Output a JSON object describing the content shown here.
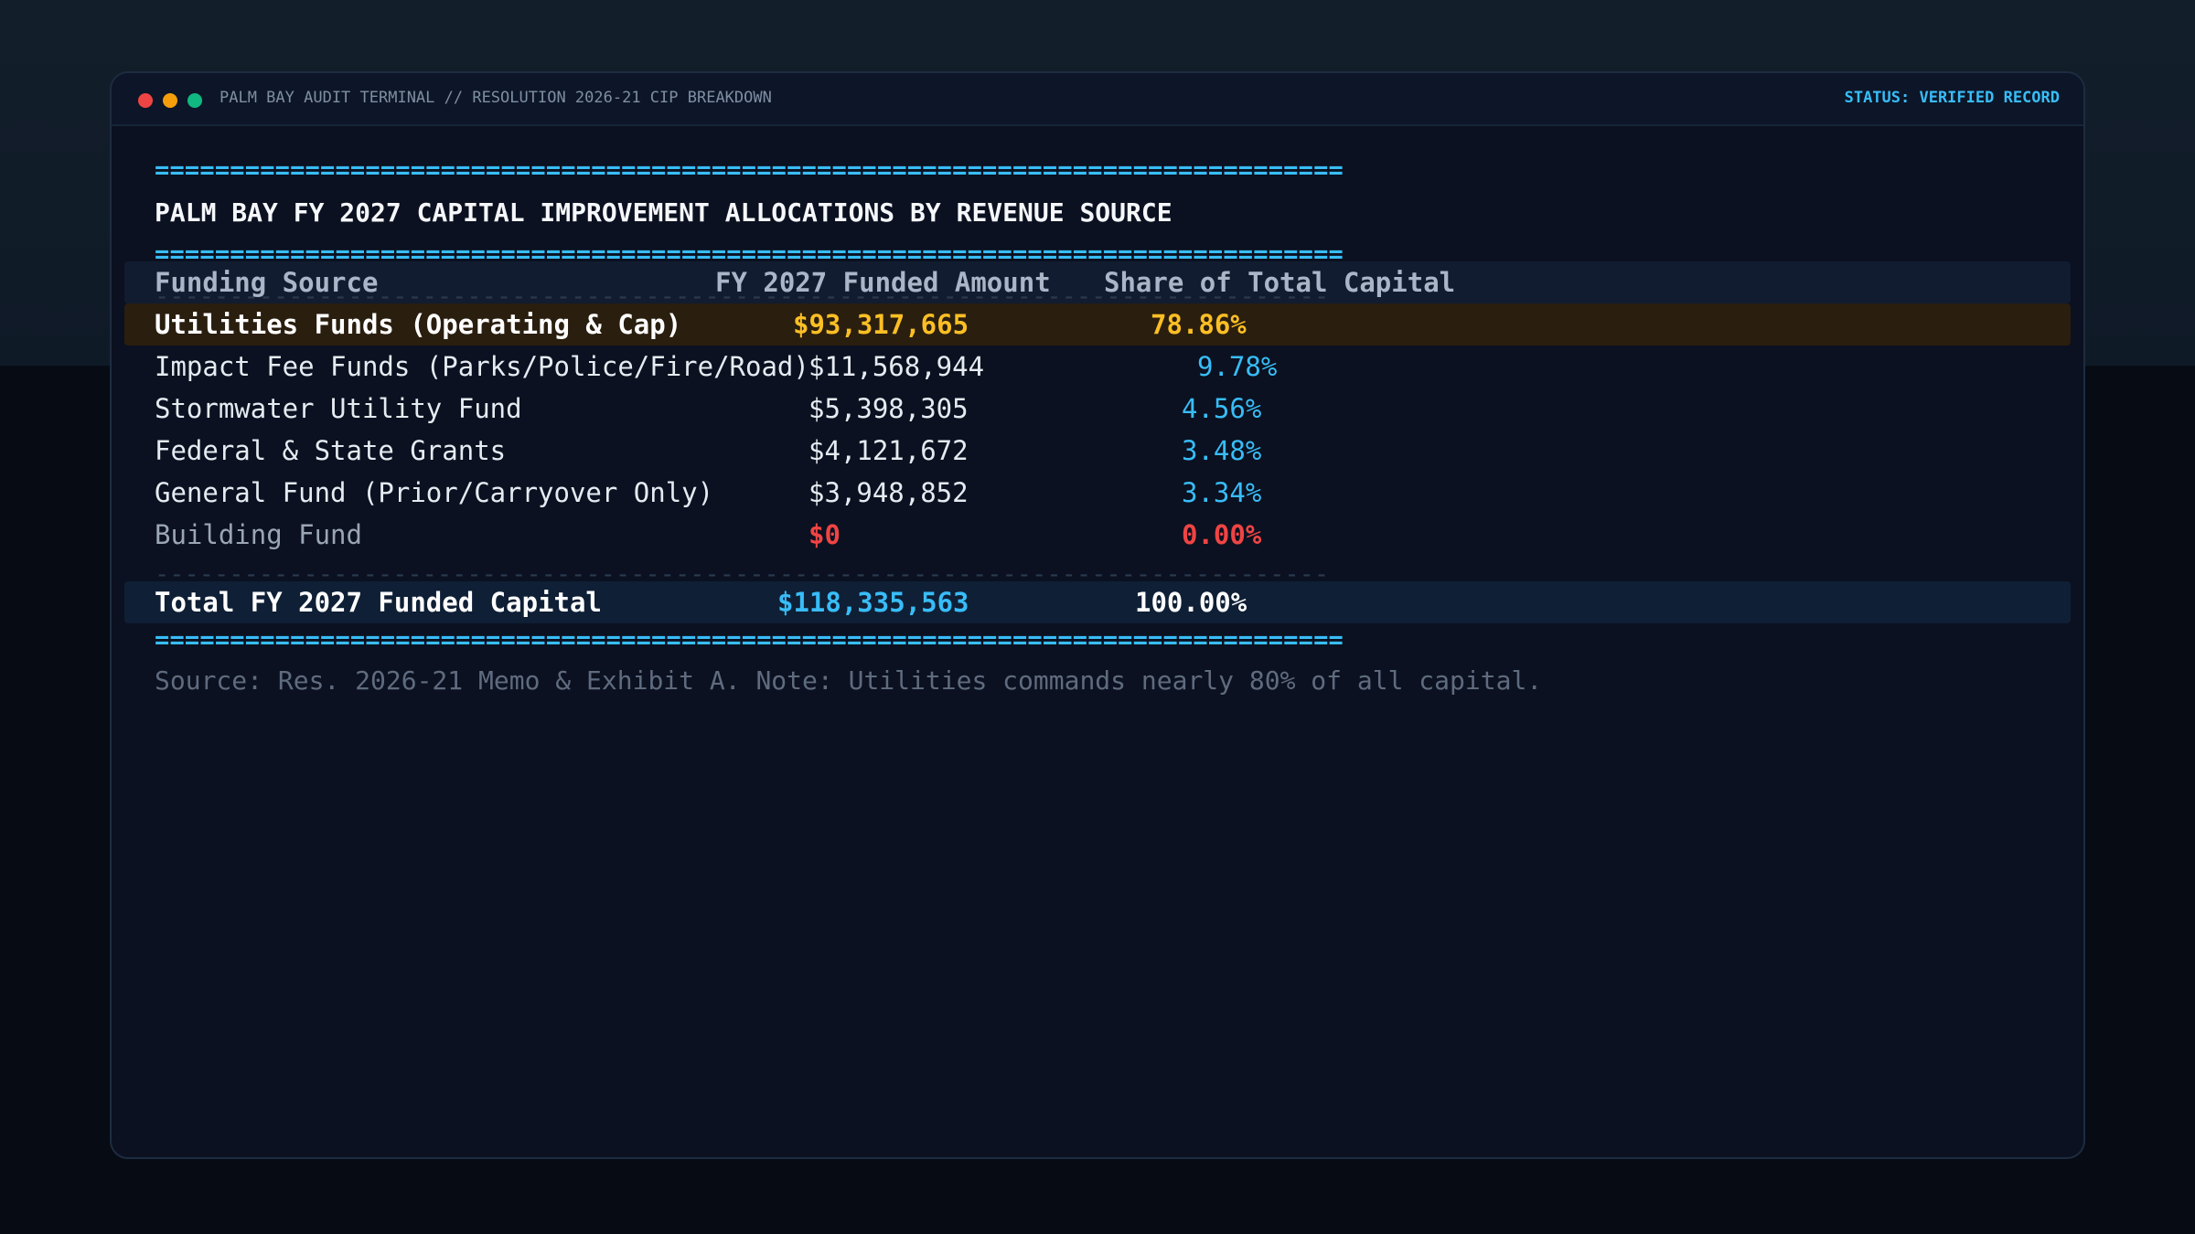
{
  "window": {
    "title": "PALM BAY AUDIT TERMINAL // RESOLUTION 2026-21 CIP BREAKDOWN",
    "status": "STATUS: VERIFIED RECORD"
  },
  "report": {
    "rule_equals": "===============================================================================",
    "rule_dashes": "-------------------------------------------------------------------------------",
    "title": "PALM BAY FY 2027 CAPITAL IMPROVEMENT ALLOCATIONS BY REVENUE SOURCE",
    "columns": {
      "source": "Funding Source",
      "amount": "FY 2027 Funded Amount",
      "share": "Share of Total Capital"
    },
    "rows": [
      {
        "source": "Utilities Funds (Operating & Cap)",
        "amount": "$93,317,665",
        "share": "78.86%"
      },
      {
        "source": "Impact Fee Funds (Parks/Police/Fire/Road)",
        "amount": "$11,568,944",
        "share": "9.78%"
      },
      {
        "source": "Stormwater Utility Fund",
        "amount": "$5,398,305",
        "share": "4.56%"
      },
      {
        "source": "Federal & State Grants",
        "amount": "$4,121,672",
        "share": "3.48%"
      },
      {
        "source": "General Fund (Prior/Carryover Only)",
        "amount": "$3,948,852",
        "share": "3.34%"
      },
      {
        "source": "Building Fund",
        "amount": "$0",
        "share": "0.00%"
      }
    ],
    "total": {
      "source": "Total FY 2027 Funded Capital",
      "amount": "$118,335,563",
      "share": "100.00%"
    },
    "footnote": "Source: Res. 2026-21 Memo & Exhibit A. Note: Utilities commands nearly 80% of all capital."
  },
  "colors": {
    "accent": "#38bdf8",
    "highlight": "#fbbf24",
    "alert": "#ef4444"
  }
}
